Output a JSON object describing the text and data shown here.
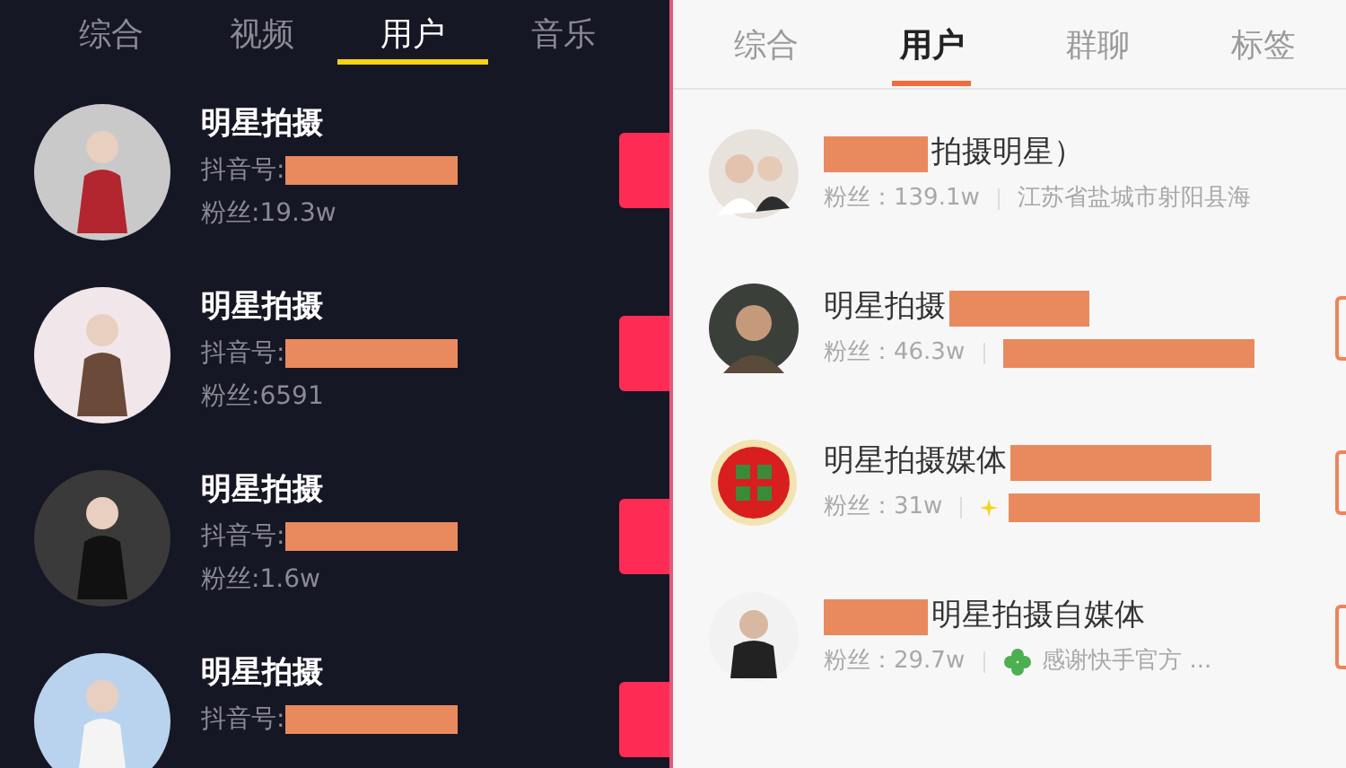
{
  "left": {
    "tabs": [
      {
        "label": "综合",
        "selected": false
      },
      {
        "label": "视频",
        "selected": false
      },
      {
        "label": "用户",
        "selected": true
      },
      {
        "label": "音乐",
        "selected": false
      }
    ],
    "users": [
      {
        "name": "明星拍摄",
        "id_label": "抖音号:",
        "fans": "粉丝:19.3w"
      },
      {
        "name": "明星拍摄",
        "id_label": "抖音号:",
        "fans": "粉丝:6591"
      },
      {
        "name": "明星拍摄",
        "id_label": "抖音号:",
        "fans": "粉丝:1.6w"
      },
      {
        "name": "明星拍摄",
        "id_label": "抖音号:"
      }
    ]
  },
  "right": {
    "tabs": [
      {
        "label": "综合",
        "selected": false
      },
      {
        "label": "用户",
        "selected": true
      },
      {
        "label": "群聊",
        "selected": false
      },
      {
        "label": "标签",
        "selected": false
      }
    ],
    "users": [
      {
        "kind": "couple",
        "name": "拍摄明星）",
        "redacted_before": true,
        "redacted_after": false,
        "fans": "粉丝：139.1w",
        "detail": "江苏省盐城市射阳县海",
        "detail_redacted": false,
        "sparkle_icon": false,
        "clover_icon": false
      },
      {
        "kind": "person",
        "name": "明星拍摄",
        "redacted_before": false,
        "redacted_after": true,
        "fans": "粉丝：46.3w",
        "detail_redacted": true,
        "sparkle_icon": false,
        "clover_icon": false
      },
      {
        "kind": "emblem",
        "name": "明星拍摄媒体",
        "redacted_before": false,
        "redacted_after": true,
        "fans": "粉丝：31w",
        "detail_redacted": true,
        "sparkle_icon": true,
        "clover_icon": false
      },
      {
        "kind": "suit",
        "name": "明星拍摄自媒体",
        "redacted_before": true,
        "redacted_after": false,
        "fans": "粉丝：29.7w",
        "detail": "感谢快手官方 ...",
        "detail_redacted": false,
        "sparkle_icon": false,
        "clover_icon": true
      }
    ]
  }
}
